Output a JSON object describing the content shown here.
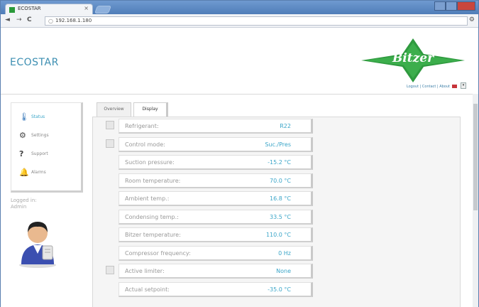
{
  "browser": {
    "tab_title": "ECOSTAR",
    "tab_close": "×",
    "url": "192.168.1.180",
    "back": "◄",
    "forward": "→",
    "reload": "C",
    "wrench": "🔧"
  },
  "header": {
    "brand": "ECOSTAR",
    "logo_text": "Bitzer",
    "links": "Logout | Contact | About",
    "logo_color": "#2f9a3f"
  },
  "sidebar": {
    "items": [
      {
        "label": "Status",
        "icon": "thermometer-icon"
      },
      {
        "label": "Settings",
        "icon": "gear-icon"
      },
      {
        "label": "Support",
        "icon": "question-icon"
      },
      {
        "label": "Alarms",
        "icon": "bell-icon"
      }
    ],
    "logged_in_label": "Logged in:",
    "logged_in_user": "Admin"
  },
  "tabs": [
    {
      "label": "Overview"
    },
    {
      "label": "Display"
    }
  ],
  "rows": [
    {
      "label": "Refrigerant:",
      "value": "R22",
      "has_button": true
    },
    {
      "label": "Control mode:",
      "value": "Suc./Pres",
      "has_button": true
    },
    {
      "label": "Suction pressure:",
      "value": "-15.2 °C",
      "has_button": false
    },
    {
      "label": "Room temperature:",
      "value": "70.0 °C",
      "has_button": false
    },
    {
      "label": "Ambient temp.:",
      "value": "16.8 °C",
      "has_button": false
    },
    {
      "label": "Condensing temp.:",
      "value": "33.5 °C",
      "has_button": false
    },
    {
      "label": "Bitzer temperature:",
      "value": "110.0 °C",
      "has_button": false
    },
    {
      "label": "Compressor frequency:",
      "value": "0 Hz",
      "has_button": false
    },
    {
      "label": "Active limiter:",
      "value": "None",
      "has_button": true
    },
    {
      "label": "Actual setpoint:",
      "value": "-35.0 °C",
      "has_button": false
    }
  ]
}
